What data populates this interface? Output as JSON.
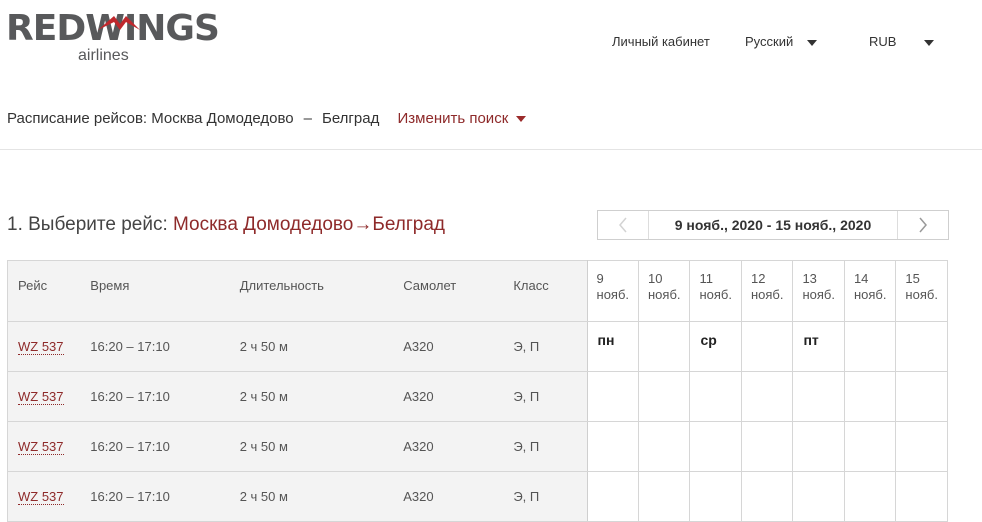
{
  "brand": {
    "logo_text": "REDWINGS",
    "logo_sub": "airlines",
    "accent_color": "#9b2b2b",
    "text_gray": "#58595b"
  },
  "nav": {
    "account": "Личный кабинет",
    "language": "Русский",
    "currency": "RUB"
  },
  "search": {
    "label": "Расписание рейсов:",
    "from": "Москва Домодедово",
    "dash": "–",
    "to": "Белград",
    "change": "Изменить поиск"
  },
  "step": {
    "label": "1. Выберите рейс:",
    "route": "Москва Домодедово→Белград"
  },
  "week": {
    "range": "9 нояб., 2020 - 15 нояб., 2020",
    "prev_icon": "chevron-left-icon",
    "next_icon": "chevron-right-icon"
  },
  "table": {
    "headers": [
      "Рейс",
      "Время",
      "Длительность",
      "Самолет",
      "Класс"
    ],
    "days": [
      {
        "num": "9",
        "mon": "нояб."
      },
      {
        "num": "10",
        "mon": "нояб."
      },
      {
        "num": "11",
        "mon": "нояб."
      },
      {
        "num": "12",
        "mon": "нояб."
      },
      {
        "num": "13",
        "mon": "нояб."
      },
      {
        "num": "14",
        "mon": "нояб."
      },
      {
        "num": "15",
        "mon": "нояб."
      }
    ],
    "rows": [
      {
        "flight": "WZ 537",
        "time": "16:20 – 17:10",
        "duration": "2 ч 50 м",
        "aircraft": "A320",
        "class": "Э, П",
        "days": [
          "пн",
          "",
          "ср",
          "",
          "пт",
          "",
          ""
        ]
      },
      {
        "flight": "WZ 537",
        "time": "16:20 – 17:10",
        "duration": "2 ч 50 м",
        "aircraft": "A320",
        "class": "Э, П",
        "days": [
          "",
          "",
          "",
          "",
          "",
          "",
          ""
        ]
      },
      {
        "flight": "WZ 537",
        "time": "16:20 – 17:10",
        "duration": "2 ч 50 м",
        "aircraft": "A320",
        "class": "Э, П",
        "days": [
          "",
          "",
          "",
          "",
          "",
          "",
          ""
        ]
      },
      {
        "flight": "WZ 537",
        "time": "16:20 – 17:10",
        "duration": "2 ч 50 м",
        "aircraft": "A320",
        "class": "Э, П",
        "days": [
          "",
          "",
          "",
          "",
          "",
          "",
          ""
        ]
      }
    ]
  }
}
